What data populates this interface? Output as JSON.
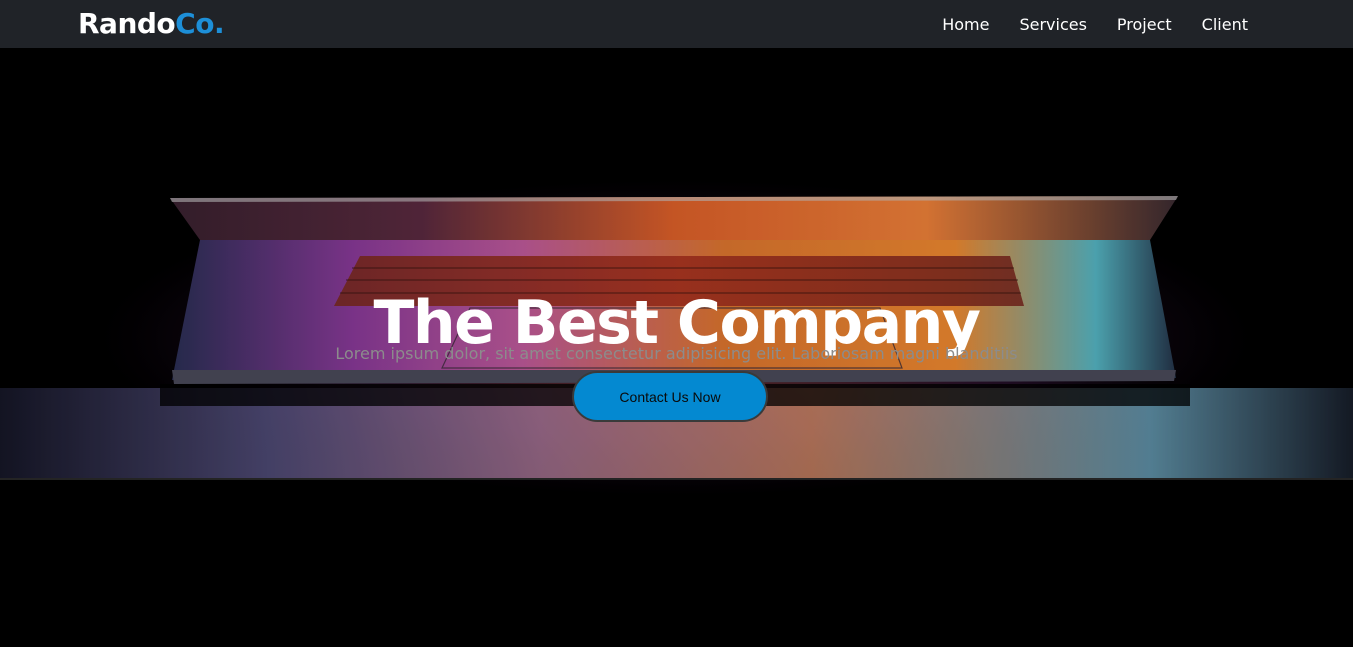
{
  "brand": {
    "name_main": "Rando",
    "name_accent": "Co.",
    "accent_color": "#1d8fd8"
  },
  "nav": {
    "items": [
      {
        "label": "Home"
      },
      {
        "label": "Services"
      },
      {
        "label": "Project"
      },
      {
        "label": "Client"
      }
    ]
  },
  "hero": {
    "title": "The Best Company",
    "subtitle": "Lorem ipsum dolor, sit amet consectetur adipisicing elit. Laboriosam magni blanditiis",
    "cta_label": "Contact Us Now",
    "cta_color": "#0489d1",
    "background_image": "laptop-partially-open-glowing-screen"
  }
}
